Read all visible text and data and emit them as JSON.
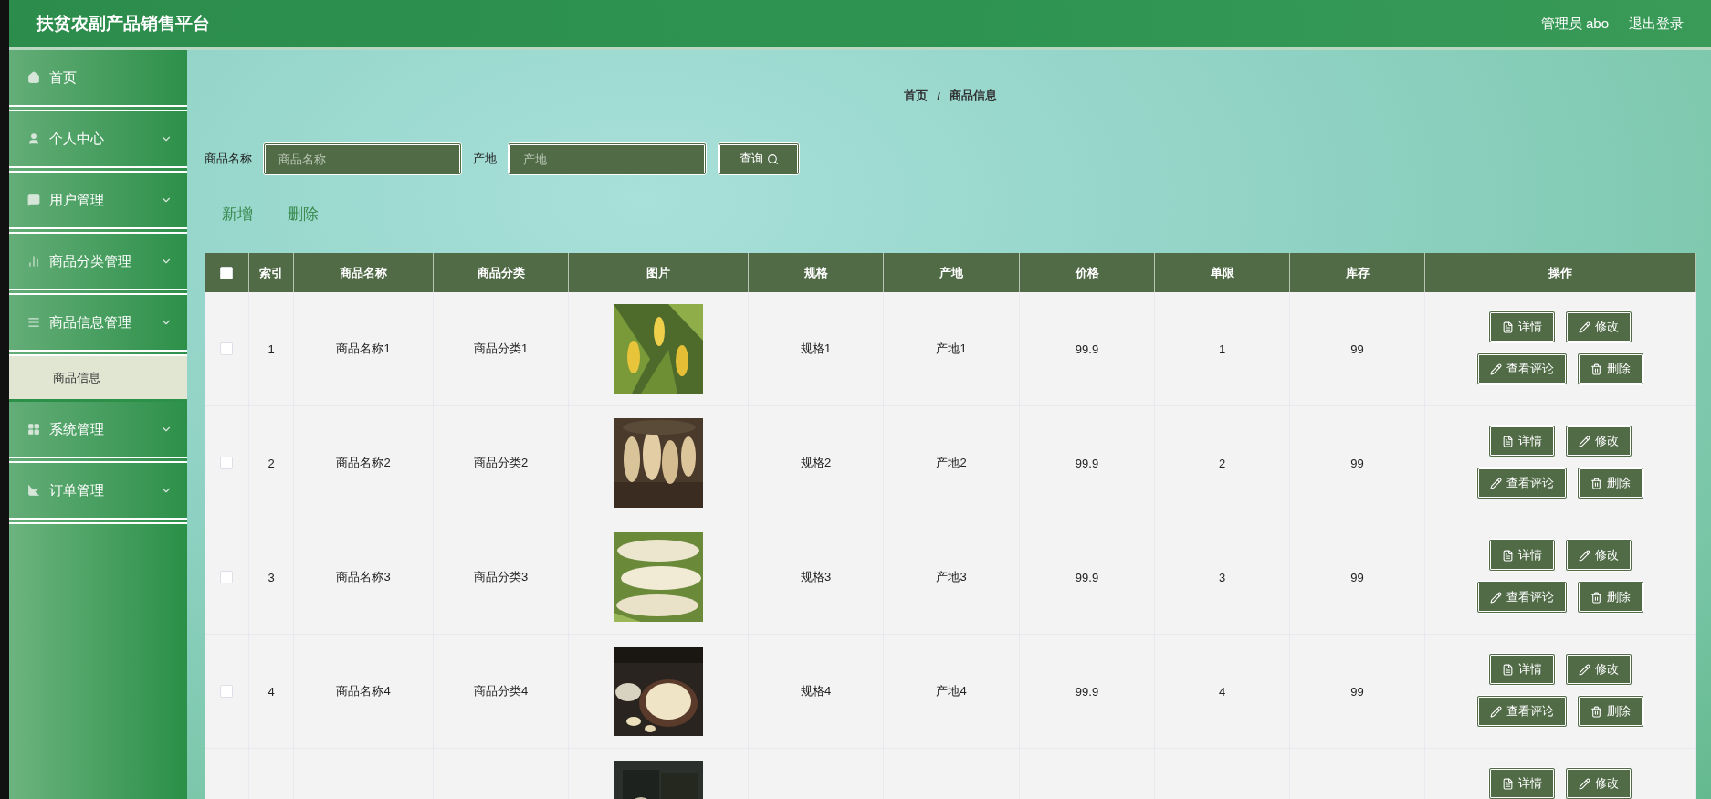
{
  "header": {
    "title": "扶贫农副产品销售平台",
    "user": "管理员 abo",
    "logout": "退出登录"
  },
  "sidebar": {
    "items": [
      {
        "label": "首页",
        "expandable": false
      },
      {
        "label": "个人中心",
        "expandable": true
      },
      {
        "label": "用户管理",
        "expandable": true
      },
      {
        "label": "商品分类管理",
        "expandable": true
      },
      {
        "label": "商品信息管理",
        "expandable": true,
        "expanded": true,
        "children": [
          {
            "label": "商品信息",
            "selected": true
          }
        ]
      },
      {
        "label": "系统管理",
        "expandable": true
      },
      {
        "label": "订单管理",
        "expandable": true
      }
    ]
  },
  "breadcrumb": {
    "items": [
      "首页",
      "商品信息"
    ],
    "separator": "/"
  },
  "search": {
    "fields": [
      {
        "label": "商品名称",
        "placeholder": "商品名称"
      },
      {
        "label": "产地",
        "placeholder": "产地"
      }
    ],
    "button": "查询"
  },
  "toolbar": [
    "新增",
    "删除"
  ],
  "table": {
    "select_all": false,
    "columns": [
      "索引",
      "商品名称",
      "商品分类",
      "图片",
      "规格",
      "产地",
      "价格",
      "单限",
      "库存",
      "操作"
    ],
    "rows": [
      {
        "checked": false,
        "cells": [
          "1",
          "商品名称1",
          "商品分类1",
          {
            "kind": "picture"
          },
          "规格1",
          "产地1",
          "99.9",
          "1",
          "99"
        ],
        "actions": [
          "详情",
          "修改",
          "查看评论",
          "删除"
        ]
      },
      {
        "checked": false,
        "cells": [
          "2",
          "商品名称2",
          "商品分类2",
          {
            "kind": "picture"
          },
          "规格2",
          "产地2",
          "99.9",
          "2",
          "99"
        ],
        "actions": [
          "详情",
          "修改",
          "查看评论",
          "删除"
        ]
      },
      {
        "checked": false,
        "cells": [
          "3",
          "商品名称3",
          "商品分类3",
          {
            "kind": "picture"
          },
          "规格3",
          "产地3",
          "99.9",
          "3",
          "99"
        ],
        "actions": [
          "详情",
          "修改",
          "查看评论",
          "删除"
        ]
      },
      {
        "checked": false,
        "cells": [
          "4",
          "商品名称4",
          "商品分类4",
          {
            "kind": "picture"
          },
          "规格4",
          "产地4",
          "99.9",
          "4",
          "99"
        ],
        "actions": [
          "详情",
          "修改",
          "查看评论",
          "删除"
        ]
      },
      {
        "cells": [
          null,
          null,
          null,
          {
            "kind": "picture"
          },
          null,
          null,
          null,
          null,
          null
        ],
        "actions": [
          "详情",
          "修改"
        ]
      }
    ]
  }
}
